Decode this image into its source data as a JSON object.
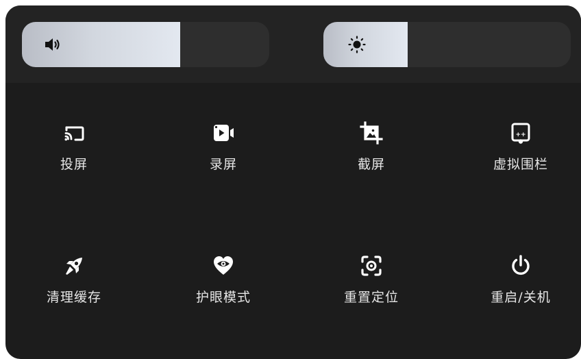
{
  "sliders": {
    "volume": {
      "level": 0.64,
      "icon": "volume-icon"
    },
    "brightness": {
      "level": 0.34,
      "icon": "brightness-icon"
    }
  },
  "tiles": [
    {
      "label": "投屏",
      "icon": "cast-icon"
    },
    {
      "label": "录屏",
      "icon": "screen-record-icon"
    },
    {
      "label": "截屏",
      "icon": "screenshot-crop-icon"
    },
    {
      "label": "虚拟围栏",
      "icon": "virtual-fence-icon"
    },
    {
      "label": "清理缓存",
      "icon": "rocket-icon"
    },
    {
      "label": "护眼模式",
      "icon": "eye-heart-icon"
    },
    {
      "label": "重置定位",
      "icon": "recenter-icon"
    },
    {
      "label": "重启/关机",
      "icon": "power-icon"
    }
  ],
  "colors": {
    "panel": "#1c1c1c",
    "slider_track": "#2e2e2e",
    "slider_fill": "#d2d7df",
    "text": "#e6e6e6"
  }
}
